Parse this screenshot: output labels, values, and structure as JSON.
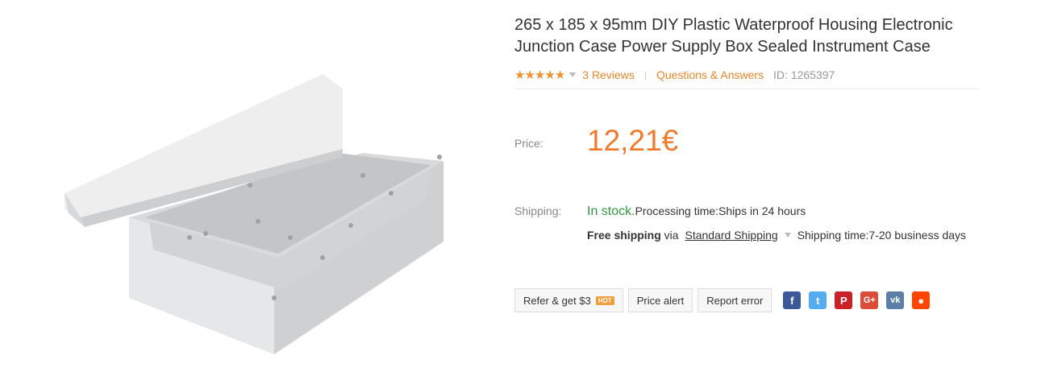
{
  "product": {
    "title_line1": "265 x 185 x 95mm DIY Plastic Waterproof Housing Electronic",
    "title_line2": "Junction Case Power Supply Box Sealed Instrument Case",
    "rating": 5,
    "reviews": "3 Reviews",
    "qa": "Questions & Answers",
    "id": "ID: 1265397",
    "price_label": "Price:",
    "price": "12,21€"
  },
  "shipping": {
    "label": "Shipping:",
    "in_stock": "In stock.",
    "processing": " Processing time:Ships in 24 hours",
    "free": "Free shipping",
    "via": " via ",
    "method": "Standard Shipping",
    "time": "Shipping time:7-20 business days"
  },
  "actions": {
    "refer": "Refer & get $3",
    "hot": "HOT",
    "price_alert": "Price alert",
    "report": "Report error"
  },
  "social": [
    {
      "icon": "facebook-icon",
      "glyph": "f",
      "color": "#3b5998"
    },
    {
      "icon": "twitter-icon",
      "glyph": "t",
      "color": "#55acee"
    },
    {
      "icon": "pinterest-icon",
      "glyph": "P",
      "color": "#cb2027"
    },
    {
      "icon": "google-plus-icon",
      "glyph": "G+",
      "color": "#dd4b39"
    },
    {
      "icon": "vk-icon",
      "glyph": "vk",
      "color": "#5b7fa6"
    },
    {
      "icon": "reddit-icon",
      "glyph": "●",
      "color": "#ff4500"
    }
  ],
  "colors": {
    "accent": "#ef7a2c",
    "stock": "#2f9a3f"
  }
}
